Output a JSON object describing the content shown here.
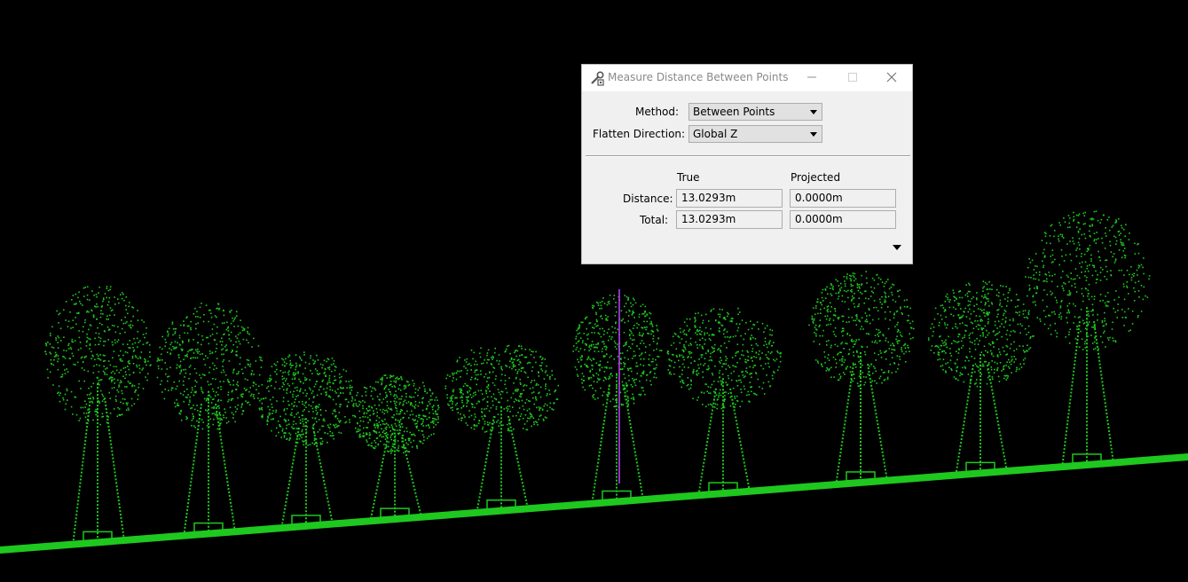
{
  "dialog": {
    "title": "Measure Distance Between Points",
    "icon": "measure-wrench-icon",
    "window_buttons": {
      "minimize": "minimize-icon",
      "maximize": "maximize-icon",
      "close": "close-icon"
    },
    "method": {
      "label": "Method:",
      "value": "Between Points"
    },
    "flatten_direction": {
      "label": "Flatten Direction:",
      "value": "Global Z"
    },
    "columns": {
      "true": "True",
      "projected": "Projected"
    },
    "distance": {
      "label": "Distance:",
      "true": "13.0293m",
      "projected": "0.0000m"
    },
    "total": {
      "label": "Total:",
      "true": "13.0293m",
      "projected": "0.0000m"
    }
  },
  "viewport": {
    "background": "#000000",
    "point_cloud_color": "#1ec81e",
    "measure_line_color": "#c040ff"
  }
}
